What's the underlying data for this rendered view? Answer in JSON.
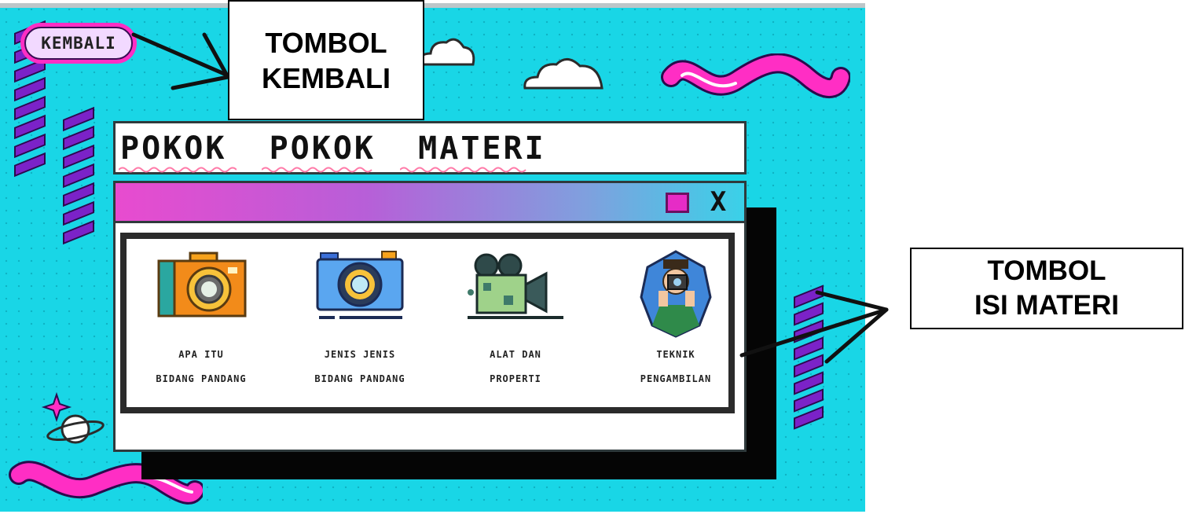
{
  "app": {
    "back_label": "KEMBALI",
    "page_title": "POKOK  POKOK  MATERI",
    "window": {
      "maximize_icon": "square-icon",
      "close_label": "X"
    }
  },
  "topics": [
    {
      "icon": "orange-camera-icon",
      "label": "APA ITU\nBIDANG PANDANG"
    },
    {
      "icon": "blue-camera-icon",
      "label": "JENIS JENIS\nBIDANG PANDANG"
    },
    {
      "icon": "film-camera-icon",
      "label": "ALAT DAN\nPROPERTI"
    },
    {
      "icon": "photographer-icon",
      "label": "TEKNIK\nPENGAMBILAN"
    }
  ],
  "annotations": {
    "back_callout": "TOMBOL\nKEMBALI",
    "topic_callout": "TOMBOL\nISI MATERI"
  },
  "colors": {
    "background": "#19d6e6",
    "accent_magenta": "#ff2ec4",
    "stripe_purple": "#7b22c8",
    "header_gradient_start": "#e84bcf",
    "header_gradient_end": "#3ad1e8"
  }
}
